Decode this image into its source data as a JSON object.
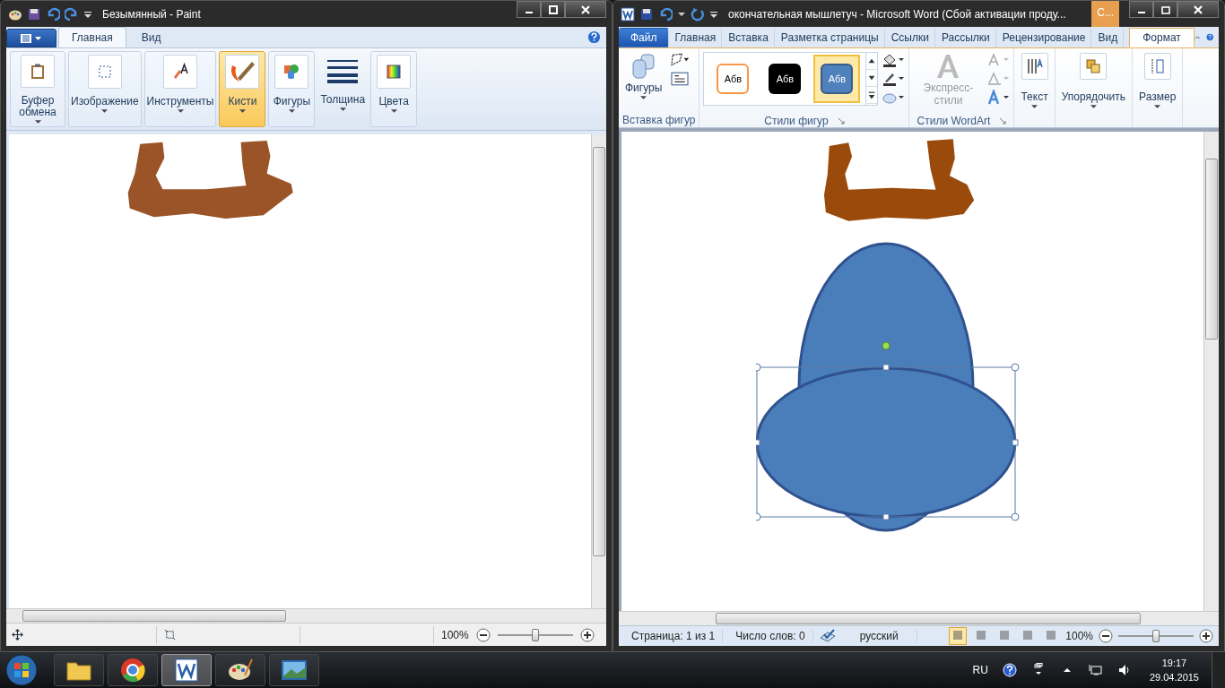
{
  "paint": {
    "title": "Безымянный - Paint",
    "tabs": [
      {
        "label": "Главная",
        "selected": true
      },
      {
        "label": "Вид",
        "selected": false
      }
    ],
    "tools": [
      {
        "kind": "clipboard",
        "label": "Буфер обмена",
        "selected": false
      },
      {
        "kind": "image",
        "label": "Изображение",
        "selected": false
      },
      {
        "kind": "tools",
        "label": "Инструменты",
        "selected": false
      },
      {
        "kind": "brushes",
        "label": "Кисти",
        "selected": true
      },
      {
        "kind": "shapes",
        "label": "Фигуры",
        "selected": false
      },
      {
        "kind": "size",
        "label": "Толщина",
        "selected": false
      },
      {
        "kind": "colors",
        "label": "Цвета",
        "selected": false
      }
    ],
    "status_bar": {
      "zoom": "100%",
      "level": 0.5
    }
  },
  "word": {
    "title": "окончательная мышлетуч  -  Microsoft Word (Сбой активации проду...",
    "contextual_tab": "С...",
    "tabs": [
      {
        "label": "Файл",
        "kind": "file",
        "selected": false
      },
      {
        "label": "Главная",
        "kind": "tab",
        "selected": false
      },
      {
        "label": "Вставка",
        "kind": "tab",
        "selected": false
      },
      {
        "label": "Разметка страницы",
        "kind": "tab",
        "selected": false
      },
      {
        "label": "Ссылки",
        "kind": "tab",
        "selected": false
      },
      {
        "label": "Рассылки",
        "kind": "tab",
        "selected": false
      },
      {
        "label": "Рецензирование",
        "kind": "tab",
        "selected": false
      },
      {
        "label": "Вид",
        "kind": "tab",
        "selected": false
      },
      {
        "label": "Формат",
        "kind": "tab",
        "selected": true
      }
    ],
    "insert_shapes": {
      "button": "Фигуры",
      "label": "Вставка фигур"
    },
    "shape_styles": {
      "label": "Стили фигур",
      "styles": [
        {
          "label": "Абв",
          "kind": "outline",
          "selected": false
        },
        {
          "label": "Абв",
          "kind": "dark",
          "selected": false
        },
        {
          "label": "Абв",
          "kind": "blue",
          "selected": true
        }
      ]
    },
    "wordart": {
      "button": "Экспресс-стили",
      "label": "Стили WordArt"
    },
    "buttons": [
      {
        "kind": "text",
        "label": "Текст"
      },
      {
        "kind": "arrange",
        "label": "Упорядочить"
      },
      {
        "kind": "size",
        "label": "Размер"
      }
    ],
    "status_bar": {
      "page": "Страница: 1 из 1",
      "words": "Число слов: 0",
      "language": "русский",
      "zoom": "100%",
      "level": 0.5,
      "views": [
        {
          "selected": true
        },
        {
          "selected": false
        },
        {
          "selected": false
        },
        {
          "selected": false
        },
        {
          "selected": false
        }
      ]
    }
  },
  "taskbar": {
    "apps": [
      {
        "kind": "folder",
        "selected": false
      },
      {
        "kind": "browser",
        "selected": false
      },
      {
        "kind": "word",
        "selected": true
      },
      {
        "kind": "paint",
        "selected": false
      },
      {
        "kind": "photo",
        "selected": false
      }
    ],
    "language": "RU",
    "time": "19:17",
    "date": "29.04.2015"
  }
}
